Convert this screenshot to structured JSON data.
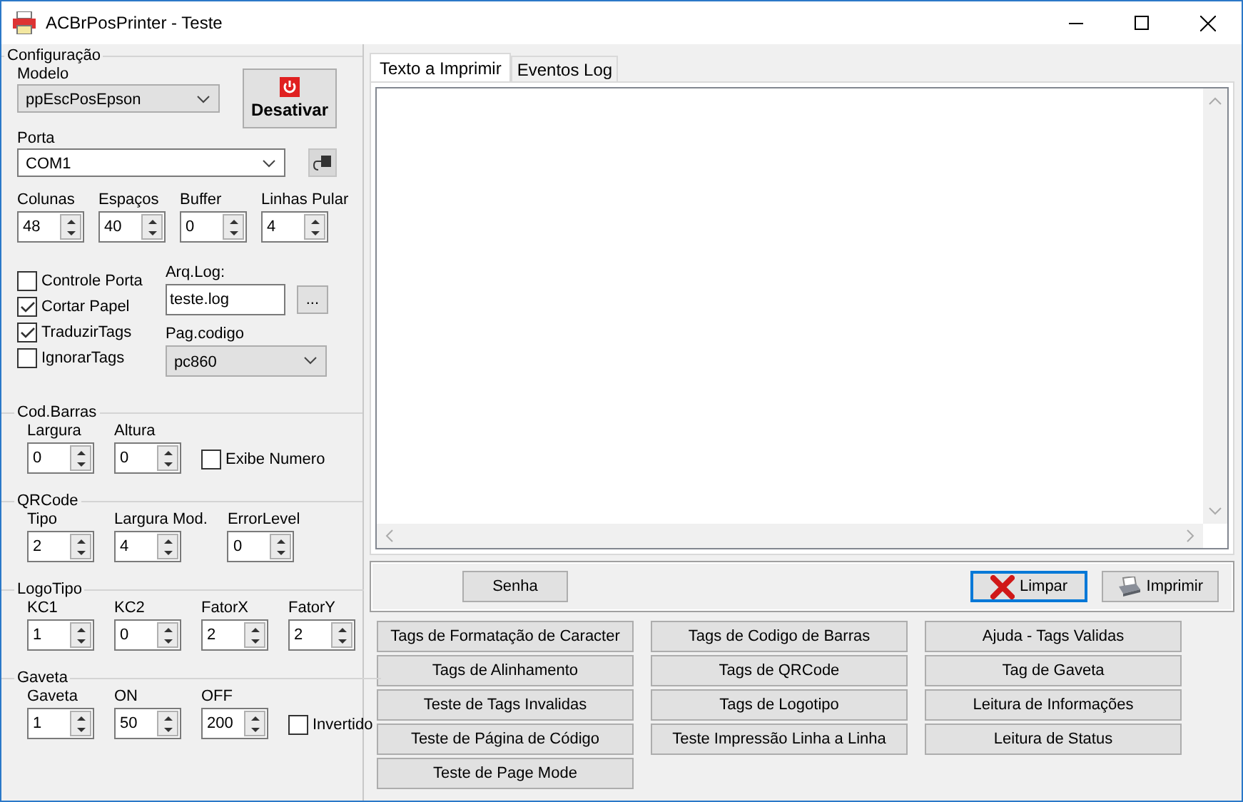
{
  "window": {
    "title": "ACBrPosPrinter - Teste"
  },
  "config": {
    "title": "Configuração",
    "model": {
      "label": "Modelo",
      "value": "ppEscPosEpson"
    },
    "power_button": "Desativar",
    "port": {
      "label": "Porta",
      "value": "COM1"
    },
    "spinners": [
      {
        "label": "Colunas",
        "value": "48"
      },
      {
        "label": "Espaços",
        "value": "40"
      },
      {
        "label": "Buffer",
        "value": "0"
      },
      {
        "label": "Linhas Pular",
        "value": "4"
      }
    ],
    "checks": [
      {
        "label": "Controle Porta",
        "checked": false
      },
      {
        "label": "Cortar Papel",
        "checked": true
      },
      {
        "label": "TraduzirTags",
        "checked": true
      },
      {
        "label": "IgnorarTags",
        "checked": false
      }
    ],
    "log": {
      "label": "Arq.Log:",
      "value": "teste.log",
      "browse": "..."
    },
    "codepage": {
      "label": "Pag.codigo",
      "value": "pc860"
    }
  },
  "sections": [
    {
      "title": "Cod.Barras",
      "items": [
        {
          "kind": "spin",
          "label": "Largura",
          "value": "0"
        },
        {
          "kind": "spin",
          "label": "Altura",
          "value": "0"
        },
        {
          "kind": "check",
          "label": "Exibe Numero",
          "checked": false
        }
      ]
    },
    {
      "title": "QRCode",
      "items": [
        {
          "kind": "spin",
          "label": "Tipo",
          "value": "2"
        },
        {
          "kind": "spin",
          "label": "Largura Mod.",
          "value": "4"
        },
        {
          "kind": "spin",
          "label": "ErrorLevel",
          "value": "0"
        }
      ]
    },
    {
      "title": "LogoTipo",
      "items": [
        {
          "kind": "spin",
          "label": "KC1",
          "value": "1"
        },
        {
          "kind": "spin",
          "label": "KC2",
          "value": "0"
        },
        {
          "kind": "spin",
          "label": "FatorX",
          "value": "2"
        },
        {
          "kind": "spin",
          "label": "FatorY",
          "value": "2"
        }
      ]
    },
    {
      "title": "Gaveta",
      "items": [
        {
          "kind": "spin",
          "label": "Gaveta",
          "value": "1"
        },
        {
          "kind": "spin",
          "label": "ON",
          "value": "50"
        },
        {
          "kind": "spin",
          "label": "OFF",
          "value": "200"
        },
        {
          "kind": "check",
          "label": "Invertido",
          "checked": false
        }
      ]
    }
  ],
  "tabs": [
    {
      "label": "Texto a Imprimir",
      "selected": true
    },
    {
      "label": "Eventos Log",
      "selected": false
    }
  ],
  "actions": {
    "password": "Senha",
    "clear": "Limpar",
    "print": "Imprimir"
  },
  "tag_buttons": [
    [
      "Tags de Formatação de Caracter",
      "Tags de Alinhamento",
      "Teste de Tags Invalidas",
      "Teste de Página de Código",
      "Teste de Page Mode"
    ],
    [
      "Tags de Codigo de Barras",
      "Tags de QRCode",
      "Tags de Logotipo",
      "Teste Impressão Linha a Linha"
    ],
    [
      "Ajuda - Tags Validas",
      "Tag de Gaveta",
      "Leitura de Informações",
      "Leitura de Status"
    ]
  ]
}
